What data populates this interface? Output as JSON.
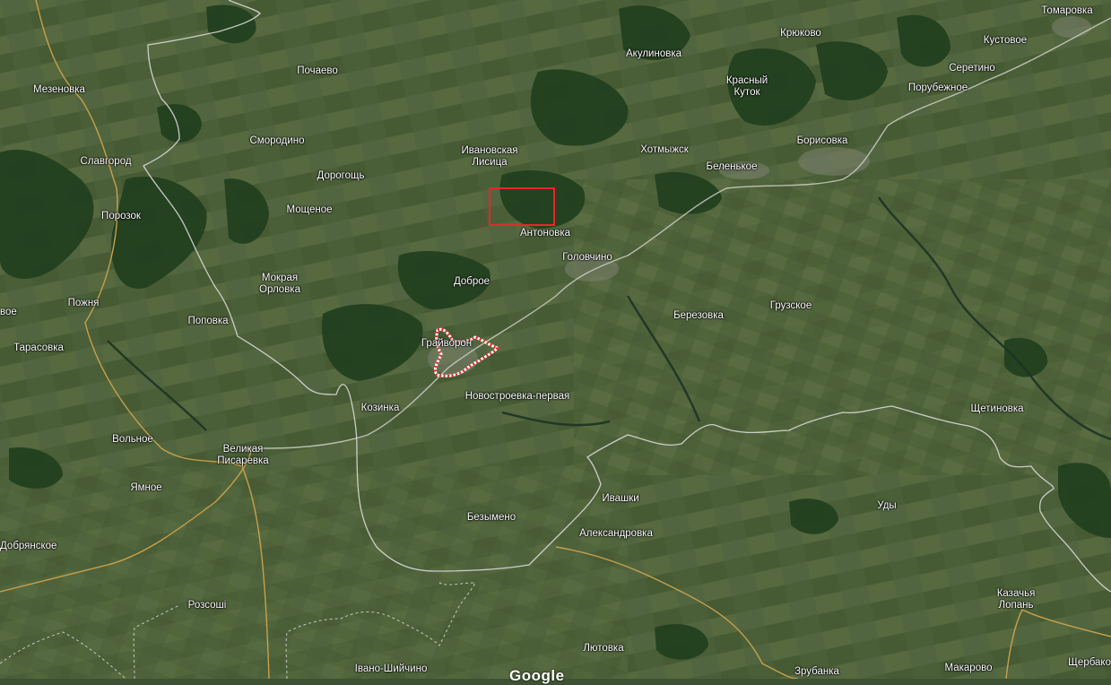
{
  "map": {
    "provider": "Google",
    "view": "satellite",
    "selection_color": "#e8262a",
    "border_color": "#d9d9d9",
    "road_color": "#c8a04a"
  },
  "places": [
    {
      "id": "tomarovka",
      "name": "Томаровка"
    },
    {
      "id": "kryukovo",
      "name": "Крюково"
    },
    {
      "id": "kustovoe",
      "name": "Кустовое"
    },
    {
      "id": "akulinovka",
      "name": "Акулиновка"
    },
    {
      "id": "seretino",
      "name": "Серетино"
    },
    {
      "id": "pochaevo",
      "name": "Почаево"
    },
    {
      "id": "krasny-kutok",
      "name": "Красный\nКуток"
    },
    {
      "id": "poruzhnoe",
      "name": "Порубежное"
    },
    {
      "id": "mezenovka",
      "name": "Мезеновка"
    },
    {
      "id": "smorodino",
      "name": "Смородино"
    },
    {
      "id": "borisovka",
      "name": "Борисовка"
    },
    {
      "id": "ivanovskaya-lisitsa",
      "name": "Ивановская\nЛисица"
    },
    {
      "id": "khotmyzhsk",
      "name": "Хотмыжск"
    },
    {
      "id": "slavgorod",
      "name": "Славгород"
    },
    {
      "id": "belenkoe",
      "name": "Беленькое"
    },
    {
      "id": "dorogoshch",
      "name": "Дорогощь"
    },
    {
      "id": "moshchenoe",
      "name": "Мощеное"
    },
    {
      "id": "porozok",
      "name": "Порозок"
    },
    {
      "id": "antonovka",
      "name": "Антоновка"
    },
    {
      "id": "golovchino",
      "name": "Головчино"
    },
    {
      "id": "mokraya-orlovka",
      "name": "Мокрая\nОрловка"
    },
    {
      "id": "dobroe",
      "name": "Доброе"
    },
    {
      "id": "gruzskoe",
      "name": "Грузское"
    },
    {
      "id": "ovoe",
      "name": "вое"
    },
    {
      "id": "pozhnya",
      "name": "Пожня"
    },
    {
      "id": "berezovka",
      "name": "Березовка"
    },
    {
      "id": "popovka",
      "name": "Поповка"
    },
    {
      "id": "graivoron",
      "name": "Грайворон"
    },
    {
      "id": "tarasovka",
      "name": "Тарасовка"
    },
    {
      "id": "novostroevka",
      "name": "Новостроевка-первая"
    },
    {
      "id": "kozinka",
      "name": "Козинка"
    },
    {
      "id": "shchetinovka",
      "name": "Щетиновка"
    },
    {
      "id": "volnoe",
      "name": "Вольное"
    },
    {
      "id": "velikaya-pisarevka",
      "name": "Великая\nПисаревка"
    },
    {
      "id": "yamnoe",
      "name": "Ямное"
    },
    {
      "id": "ivashki",
      "name": "Ивашки"
    },
    {
      "id": "udy",
      "name": "Уды"
    },
    {
      "id": "bezymeno",
      "name": "Безымено"
    },
    {
      "id": "aleksandrovka",
      "name": "Александровка"
    },
    {
      "id": "dobryanskoe",
      "name": "Добрянское"
    },
    {
      "id": "kazachya-lopan",
      "name": "Казачья\nЛопань"
    },
    {
      "id": "rozsoshi",
      "name": "Розсоші"
    },
    {
      "id": "lyutovka",
      "name": "Лютовка"
    },
    {
      "id": "shcherbaki",
      "name": "Щербако"
    },
    {
      "id": "ivano-shiychino",
      "name": "Івано-Шийчино"
    },
    {
      "id": "zrubanka",
      "name": "Зрубанка"
    },
    {
      "id": "makarovo",
      "name": "Макарово"
    }
  ]
}
